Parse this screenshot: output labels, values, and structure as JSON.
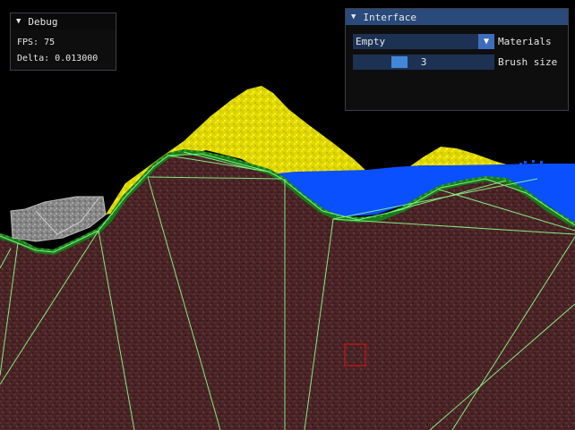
{
  "debug_window": {
    "title": "Debug",
    "fps_text": "FPS: 75",
    "delta_text": "Delta: 0.013000"
  },
  "interface_window": {
    "title": "Interface",
    "materials": {
      "selected": "Empty",
      "label": "Materials"
    },
    "brush_size": {
      "value": "3",
      "label": "Brush size",
      "fraction": 0.3
    }
  },
  "colors": {
    "dirt": "#4a2426",
    "sand": "#e0d800",
    "water": "#0a50ff",
    "grass": "#1a7a1a",
    "rock": "#8a8a8a",
    "collider_line": "#8cff8c",
    "cursor": "#dd1111",
    "title_active": "#294a7a",
    "widget_bg": "#1d3253",
    "widget_accent": "#4288d9"
  },
  "icons": {
    "collapse": "collapse-triangle-icon",
    "dropdown": "dropdown-arrow-icon"
  }
}
